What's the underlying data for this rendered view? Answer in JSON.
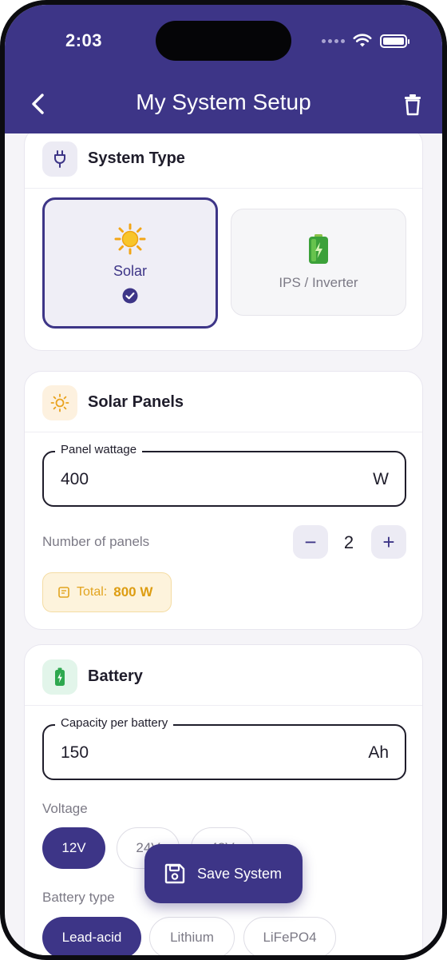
{
  "status": {
    "time": "2:03"
  },
  "nav": {
    "title": "My System Setup"
  },
  "system_type": {
    "title": "System Type",
    "options": [
      {
        "label": "Solar",
        "selected": true
      },
      {
        "label": "IPS / Inverter",
        "selected": false
      }
    ]
  },
  "solar_panels": {
    "title": "Solar Panels",
    "wattage": {
      "label": "Panel wattage",
      "value": "400",
      "unit": "W"
    },
    "count": {
      "label": "Number of panels",
      "value": "2",
      "decrement": "−",
      "increment": "+"
    },
    "total": {
      "label": "Total:",
      "value": "800 W"
    }
  },
  "battery": {
    "title": "Battery",
    "capacity": {
      "label": "Capacity per battery",
      "value": "150",
      "unit": "Ah"
    },
    "voltage": {
      "label": "Voltage",
      "options": [
        "12V",
        "24V",
        "48V"
      ],
      "selected": "12V"
    },
    "type": {
      "label": "Battery type",
      "options": [
        "Lead-acid",
        "Lithium",
        "LiFePO4"
      ],
      "selected": "Lead-acid"
    }
  },
  "fab": {
    "label": "Save System"
  },
  "colors": {
    "primary": "#3d3587",
    "accent_yellow": "#e2a41f",
    "battery_green": "#2ea84f"
  }
}
